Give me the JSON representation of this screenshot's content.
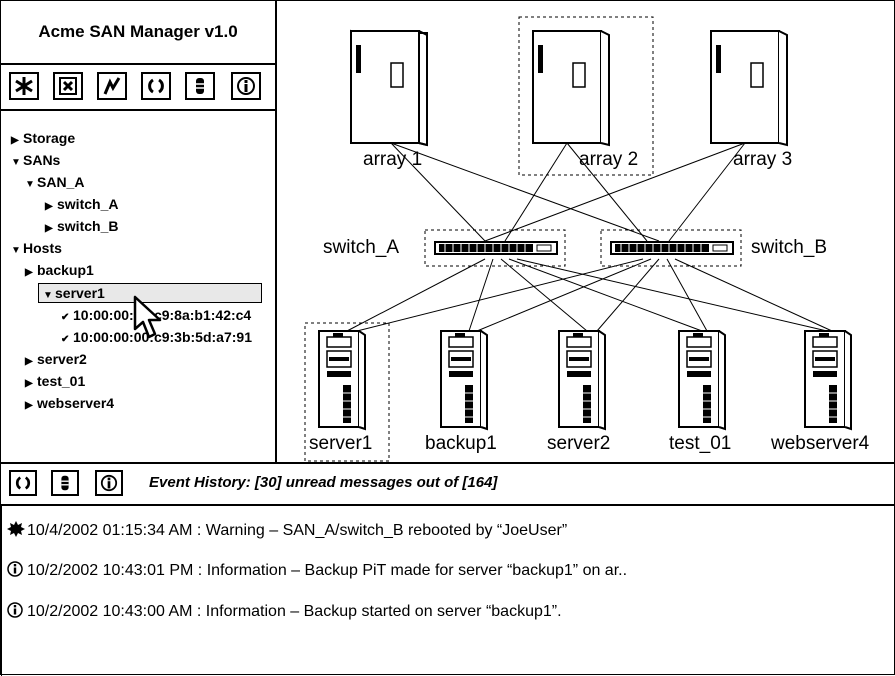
{
  "app": {
    "title": "Acme SAN Manager v1.0"
  },
  "toolbar": {
    "buttons": [
      "asterisk-icon",
      "close-box-icon",
      "lightning-icon",
      "refresh-icon",
      "database-icon",
      "info-icon"
    ]
  },
  "tree": {
    "items": [
      {
        "label": "Storage",
        "expanded": false
      },
      {
        "label": "SANs",
        "expanded": true
      },
      {
        "label": "SAN_A",
        "expanded": true
      },
      {
        "label": "switch_A",
        "expanded": false
      },
      {
        "label": "switch_B",
        "expanded": false
      },
      {
        "label": "Hosts",
        "expanded": true
      },
      {
        "label": "backup1",
        "expanded": false
      },
      {
        "label": "server1",
        "expanded": true
      },
      {
        "label": "10:00:00:00:c9:8a:b1:42:c4",
        "checked": true
      },
      {
        "label": "10:00:00:00:c9:3b:5d:a7:91",
        "checked": true
      },
      {
        "label": "server2",
        "expanded": false
      },
      {
        "label": "test_01",
        "expanded": false
      },
      {
        "label": "webserver4",
        "expanded": false
      }
    ]
  },
  "diagram": {
    "arrays": [
      "array 1",
      "array 2",
      "array 3"
    ],
    "switches": [
      "switch_A",
      "switch_B"
    ],
    "hosts": [
      "server1",
      "backup1",
      "server2",
      "test_01",
      "webserver4"
    ]
  },
  "events": {
    "header": "Event History: [30] unread messages out of [164]",
    "messages": [
      {
        "icon": "warning-burst-icon",
        "text": "10/4/2002 01:15:34 AM : Warning – SAN_A/switch_B rebooted by “JoeUser”"
      },
      {
        "icon": "info-icon",
        "text": "10/2/2002 10:43:01 PM : Information – Backup PiT made for server “backup1” on ar.."
      },
      {
        "icon": "info-icon",
        "text": "10/2/2002 10:43:00 AM : Information – Backup started on server “backup1”."
      }
    ]
  }
}
